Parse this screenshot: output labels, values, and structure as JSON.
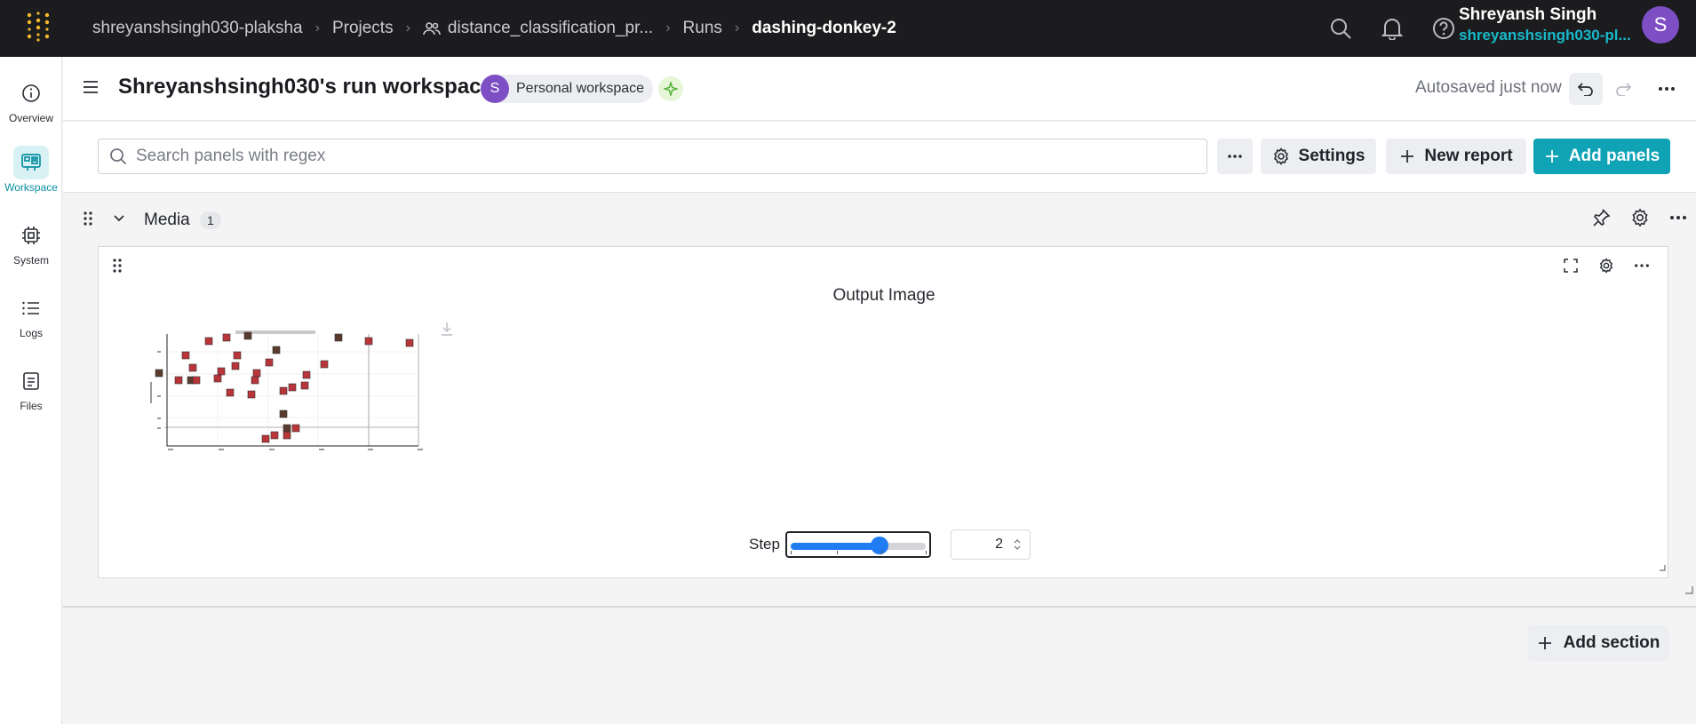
{
  "topbar": {
    "breadcrumbs": {
      "entity": "shreyanshsingh030-plaksha",
      "projects": "Projects",
      "project": "distance_classification_pr...",
      "runs": "Runs",
      "run": "dashing-donkey-2"
    },
    "user": {
      "name": "Shreyansh Singh",
      "handle": "shreyanshsingh030-pl...",
      "avatar_letter": "S"
    }
  },
  "leftnav": {
    "items": [
      {
        "label": "Overview",
        "icon": "info-icon"
      },
      {
        "label": "Workspace",
        "icon": "workspace-icon",
        "active": true
      },
      {
        "label": "System",
        "icon": "chip-icon"
      },
      {
        "label": "Logs",
        "icon": "list-icon"
      },
      {
        "label": "Files",
        "icon": "file-icon"
      }
    ]
  },
  "header": {
    "title": "Shreyanshsingh030's run workspace",
    "badge_letter": "S",
    "badge_label": "Personal workspace",
    "autosave": "Autosaved just now"
  },
  "toolbar": {
    "search_placeholder": "Search panels with regex",
    "settings": "Settings",
    "new_report": "New report",
    "add_panels": "Add panels"
  },
  "section": {
    "title": "Media",
    "count": "1"
  },
  "panel": {
    "title": "Output Image",
    "step_label": "Step",
    "step_value": "2",
    "slider_fraction": 0.66
  },
  "footer": {
    "add_section": "Add section"
  },
  "colors": {
    "topbar": "#1c1c1f",
    "accent": "#10a3b6",
    "avatar": "#7e4fc4",
    "slider": "#1f7cf2"
  }
}
